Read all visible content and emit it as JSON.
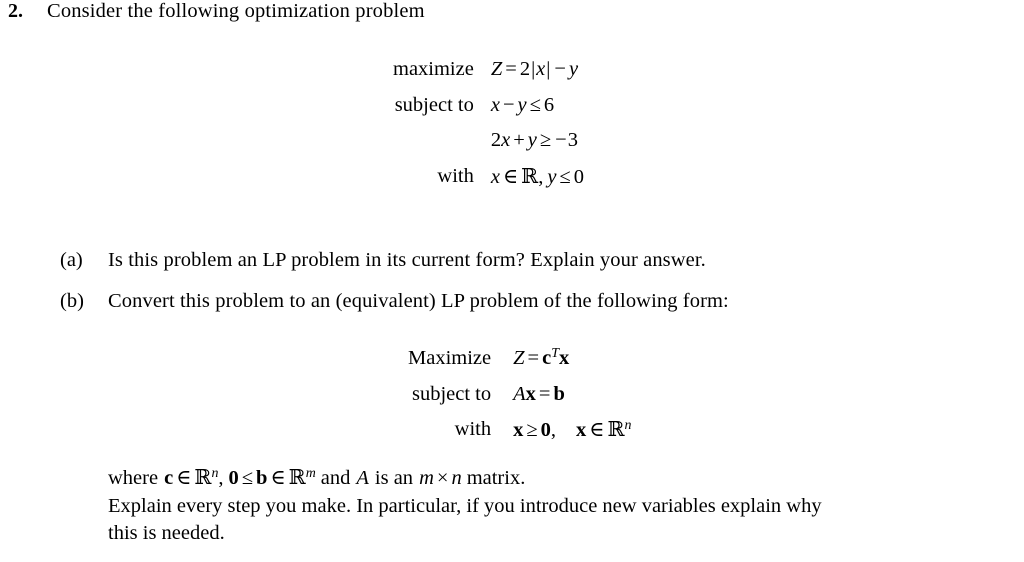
{
  "document": {
    "background_color": "#ffffff",
    "text_color": "#000000"
  },
  "problem": {
    "number": "2.",
    "statement": "Consider the following optimization problem"
  },
  "math_block_primal": {
    "rows": [
      {
        "label": "maximize",
        "expression": "Z = 2|x| − y"
      },
      {
        "label": "subject to",
        "expression": "x − y ≤ 6"
      },
      {
        "label": "",
        "expression": "2x + y ≥ −3"
      },
      {
        "label": "with",
        "expression": "x ∈ ℝ, y ≤ 0"
      }
    ]
  },
  "subquestions": [
    {
      "marker": "(a)",
      "text": "Is this problem an LP problem in its current form?  Explain your answer."
    },
    {
      "marker": "(b)",
      "text": "Convert this problem to an (equivalent) LP problem of the following form:"
    }
  ],
  "math_block_standard": {
    "rows": [
      {
        "label": "Maximize",
        "expression": "Z = cᵀx"
      },
      {
        "label": "subject to",
        "expression": "Ax = b"
      },
      {
        "label": "with",
        "expression": "x ≥ 0,   x ∈ ℝⁿ"
      }
    ]
  },
  "trailing": {
    "line1": "where c ∈ ℝⁿ, 0 ≤ b ∈ ℝᵐ and A is an m × n matrix.",
    "line2": "Explain every step you make.  In particular, if you introduce new variables explain why",
    "line3": "this is needed."
  },
  "glyphs": {
    "leq": "≤",
    "geq": "≥",
    "in": "∈",
    "times": "×",
    "minus": "−",
    "plus": "+",
    "equals": "=",
    "reals": "ℝ",
    "abs_bar": "|"
  }
}
